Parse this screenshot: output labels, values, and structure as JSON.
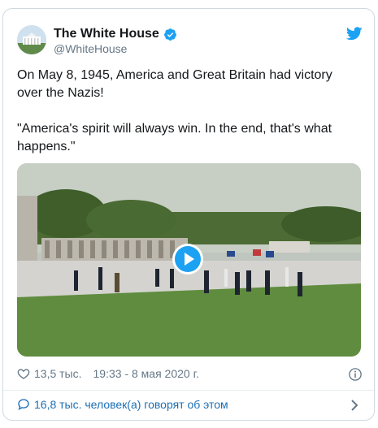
{
  "tweet": {
    "author_name": "The White House",
    "author_handle": "@WhiteHouse",
    "text": "On May 8, 1945, America and Great Britain had victory over the Nazis!\n\n\"America's spirit will always win. In the end, that's what happens.\"",
    "likes": "13,5 тыс.",
    "timestamp": "19:33 - 8 мая 2020 г.",
    "discussion": "16,8 тыс. человек(а) говорят об этом"
  },
  "icons": {
    "verified": "verified-badge-icon",
    "bird": "twitter-bird-icon",
    "play": "play-icon",
    "heart": "heart-icon",
    "info": "info-icon",
    "bubble": "speech-bubble-icon",
    "chevron": "chevron-right-icon"
  },
  "colors": {
    "brand": "#1da1f2",
    "link": "#1b6fb5",
    "muted": "#657786"
  }
}
